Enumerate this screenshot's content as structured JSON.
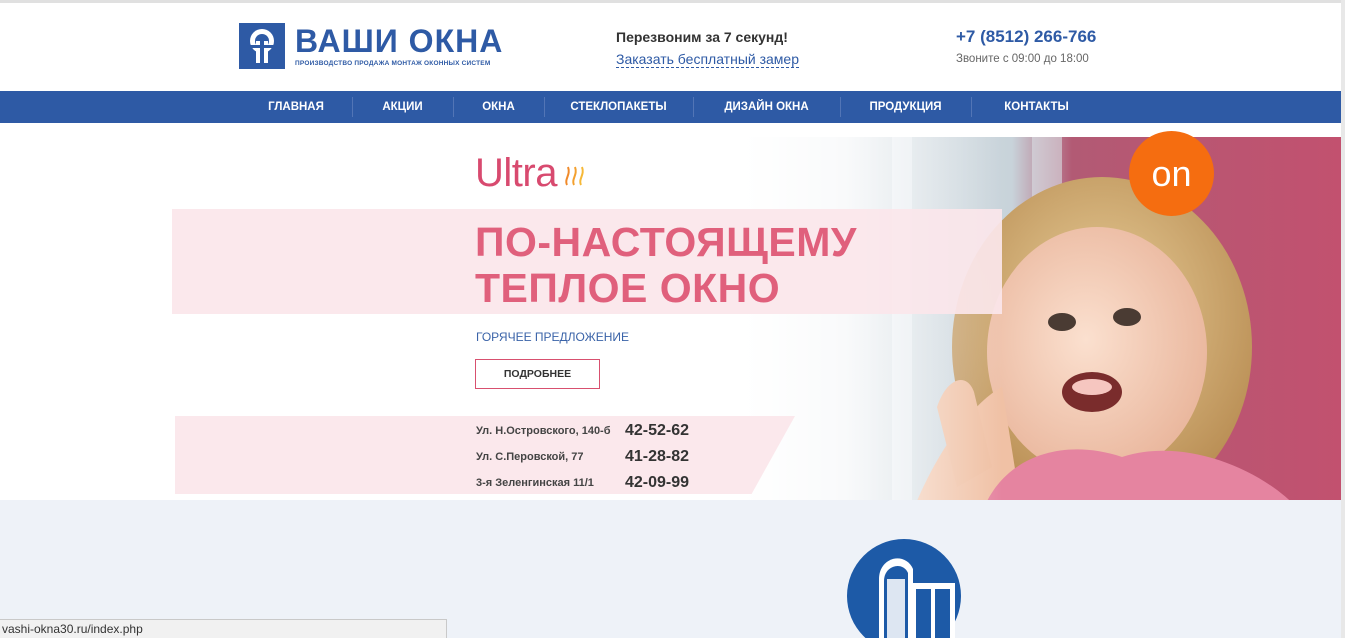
{
  "header": {
    "logo_title": "ВАШИ ОКНА",
    "logo_subtitle": "ПРОИЗВОДСТВО ПРОДАЖА МОНТАЖ ОКОННЫХ СИСТЕМ",
    "callback_title": "Перезвоним за 7 секунд!",
    "callback_link": "Заказать бесплатный замер",
    "phone": "+7 (8512) 266-766",
    "hours": "Звоните с 09:00 до 18:00"
  },
  "nav": {
    "items": [
      {
        "label": "ГЛАВНАЯ"
      },
      {
        "label": "АКЦИИ"
      },
      {
        "label": "ОКНА"
      },
      {
        "label": "СТЕКЛОПАКЕТЫ"
      },
      {
        "label": "ДИЗАЙН ОКНА"
      },
      {
        "label": "ПРОДУКЦИЯ"
      },
      {
        "label": "КОНТАКТЫ"
      }
    ]
  },
  "hero": {
    "brand": "Ultra",
    "headline_line1": "ПО-НАСТОЯЩЕМУ",
    "headline_line2": "ТЕПЛОЕ ОКНО",
    "offer": "ГОРЯЧЕЕ ПРЕДЛОЖЕНИЕ",
    "button": "ПОДРОБНЕЕ",
    "badge": "on",
    "addresses": [
      {
        "address": "Ул. Н.Островского, 140-б",
        "phone": "42-52-62"
      },
      {
        "address": "Ул. С.Перовской, 77",
        "phone": "41-28-82"
      },
      {
        "address": "3-я Зеленгинская 11/1",
        "phone": "42-09-99"
      }
    ]
  },
  "status_bar": {
    "url": "vashi-okna30.ru/index.php"
  },
  "colors": {
    "brand_blue": "#2e5aa5",
    "accent_pink": "#e0607c",
    "badge_orange": "#f56d10"
  }
}
